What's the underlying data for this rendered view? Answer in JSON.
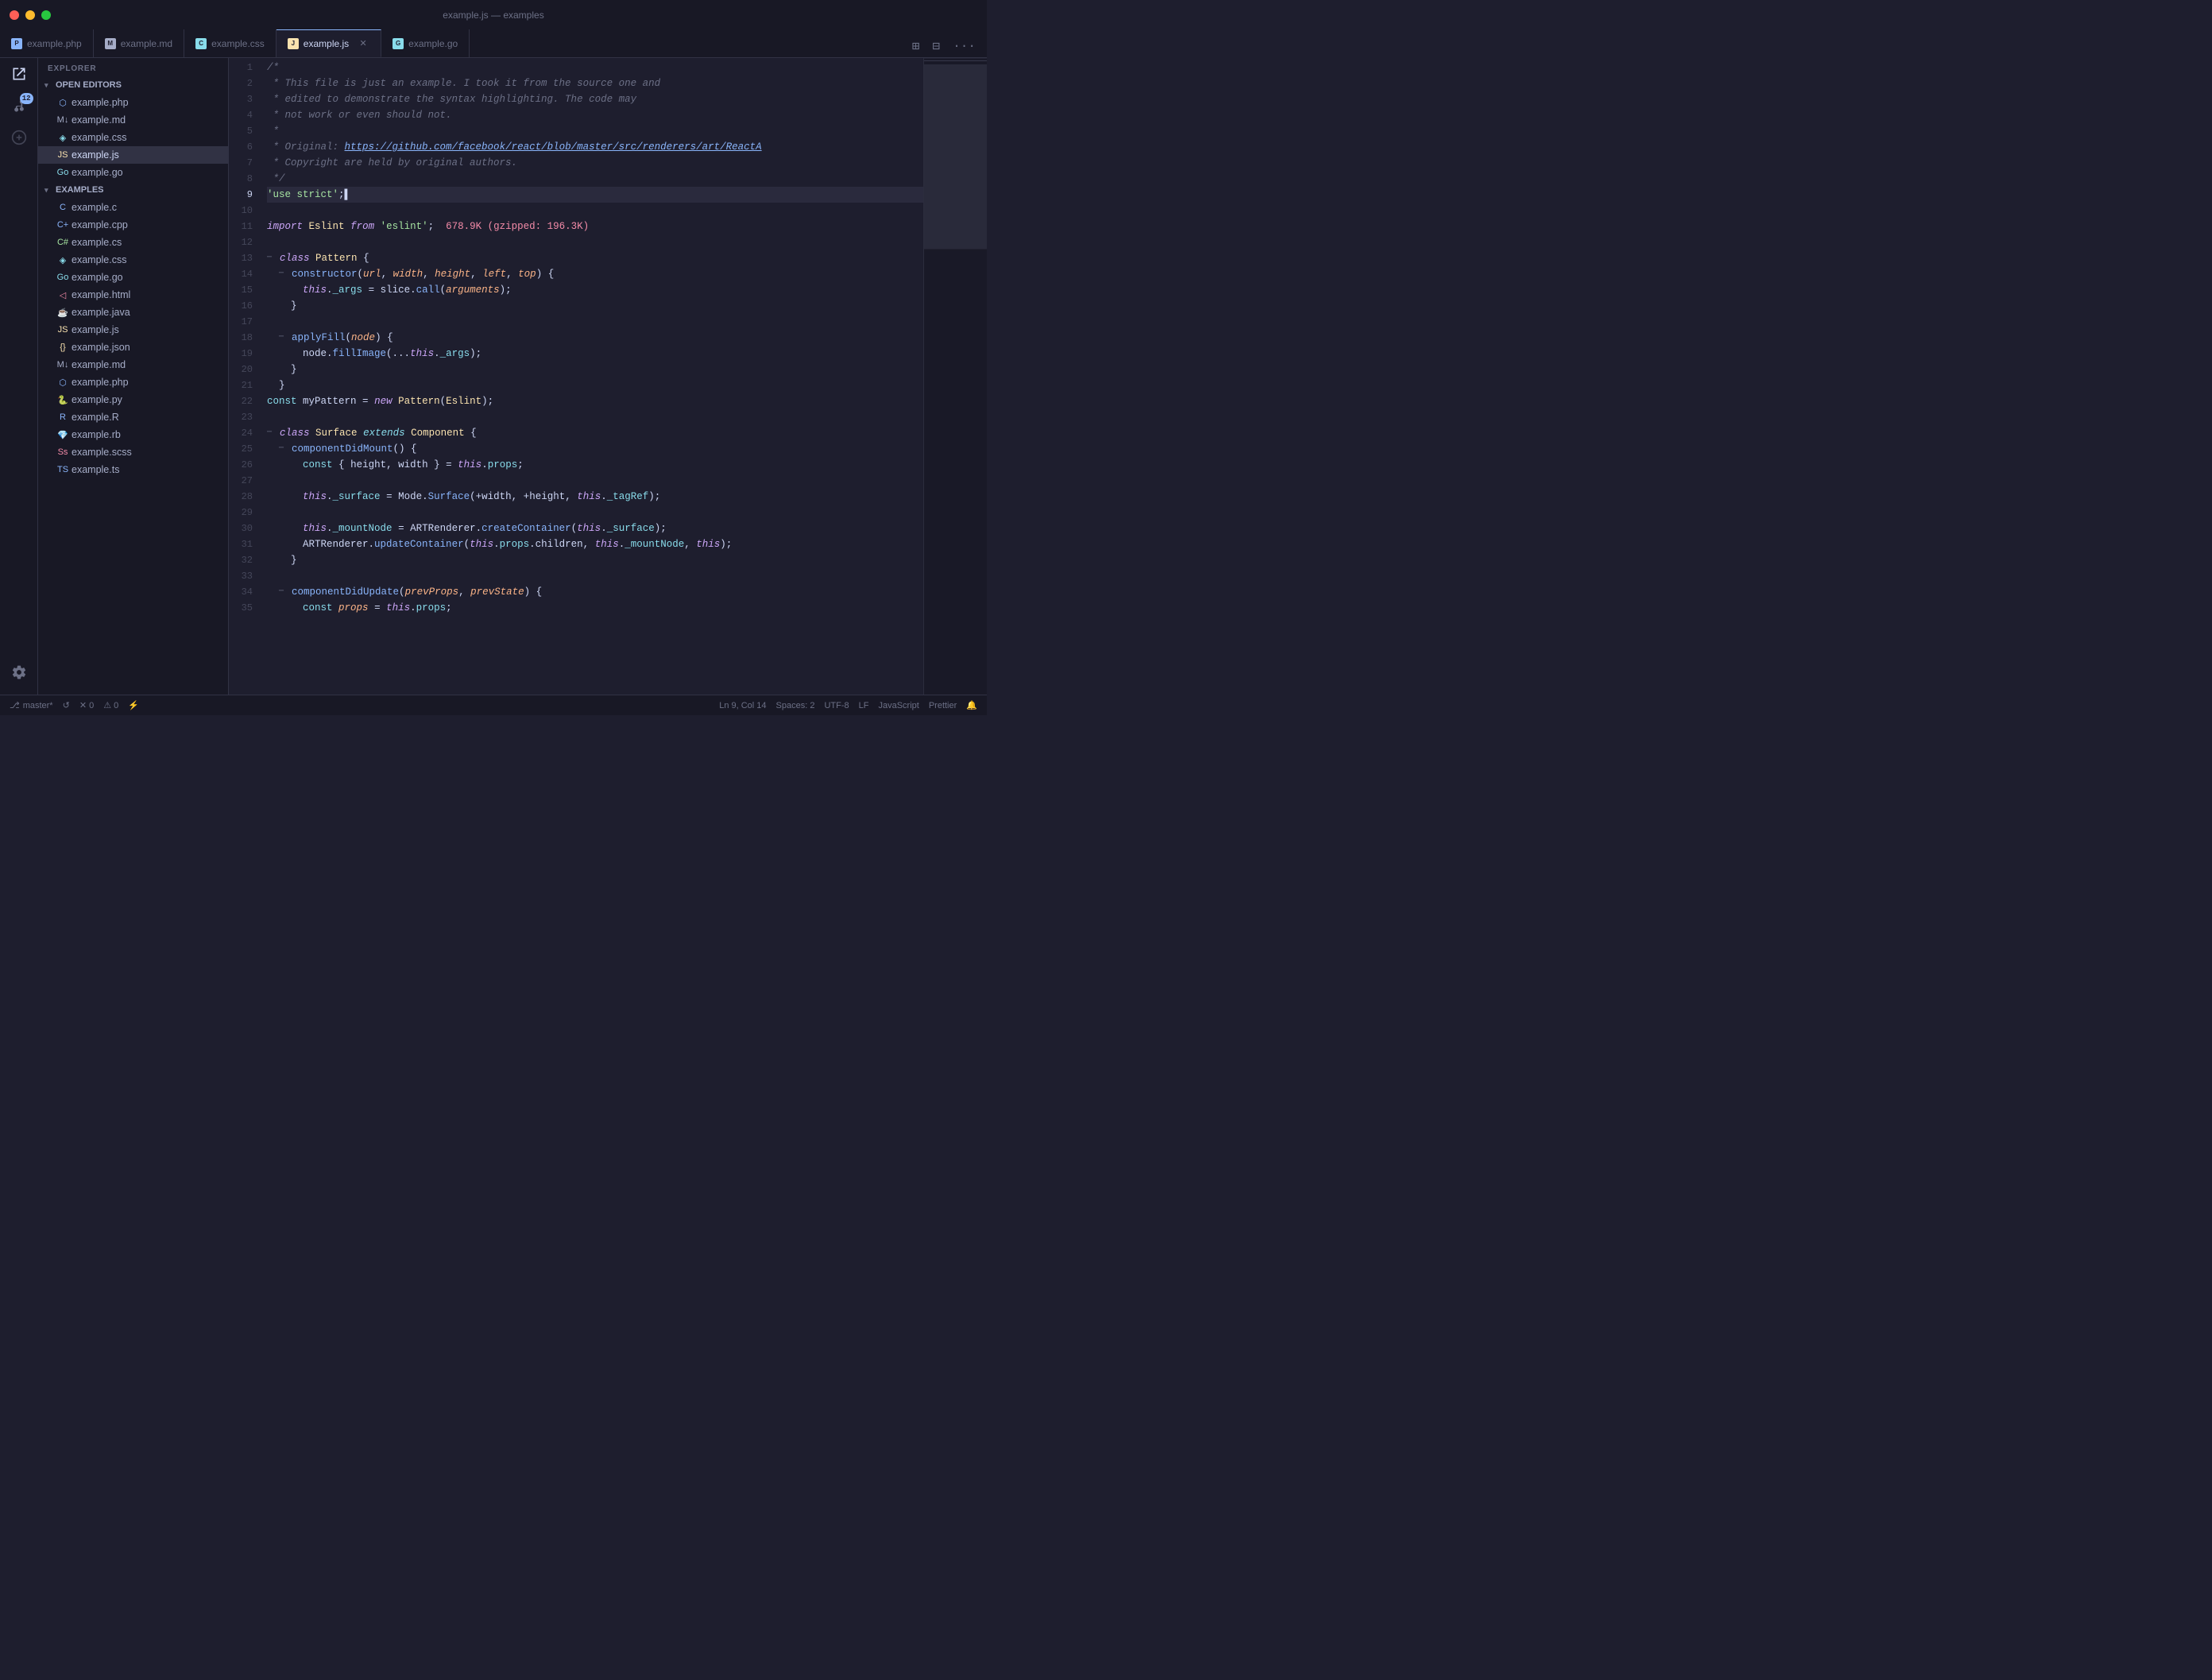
{
  "window": {
    "title": "example.js — examples"
  },
  "tabs": [
    {
      "id": "example-php",
      "label": "example.php",
      "icon_color": "#89b4fa",
      "icon_type": "php",
      "active": false
    },
    {
      "id": "example-md",
      "label": "example.md",
      "icon_color": "#a6adc8",
      "icon_type": "md",
      "active": false
    },
    {
      "id": "example-css",
      "label": "example.css",
      "icon_color": "#89dceb",
      "icon_type": "css",
      "active": false
    },
    {
      "id": "example-js",
      "label": "example.js",
      "icon_color": "#f9e2af",
      "icon_type": "js",
      "active": true,
      "closeable": true
    },
    {
      "id": "example-go",
      "label": "example.go",
      "icon_color": "#89dceb",
      "icon_type": "go",
      "active": false
    }
  ],
  "sidebar": {
    "open_editors_title": "OPEN EDITORS",
    "open_editors": [
      {
        "label": "example.php",
        "icon_color": "#89b4fa"
      },
      {
        "label": "example.md",
        "icon_color": "#a6adc8"
      },
      {
        "label": "example.css",
        "icon_color": "#89dceb"
      },
      {
        "label": "example.js",
        "icon_color": "#f9e2af",
        "active": true
      },
      {
        "label": "example.go",
        "icon_color": "#89dceb"
      }
    ],
    "examples_title": "EXAMPLES",
    "examples": [
      {
        "label": "example.c",
        "icon_color": "#89b4fa"
      },
      {
        "label": "example.cpp",
        "icon_color": "#89b4fa"
      },
      {
        "label": "example.cs",
        "icon_color": "#a6e3a1"
      },
      {
        "label": "example.css",
        "icon_color": "#89dceb"
      },
      {
        "label": "example.go",
        "icon_color": "#89dceb"
      },
      {
        "label": "example.html",
        "icon_color": "#f38ba8"
      },
      {
        "label": "example.java",
        "icon_color": "#f38ba8"
      },
      {
        "label": "example.js",
        "icon_color": "#f9e2af"
      },
      {
        "label": "example.json",
        "icon_color": "#f9e2af"
      },
      {
        "label": "example.md",
        "icon_color": "#a6adc8"
      },
      {
        "label": "example.php",
        "icon_color": "#89b4fa"
      },
      {
        "label": "example.py",
        "icon_color": "#f9e2af"
      },
      {
        "label": "example.R",
        "icon_color": "#89b4fa"
      },
      {
        "label": "example.rb",
        "icon_color": "#f38ba8"
      },
      {
        "label": "example.scss",
        "icon_color": "#f38ba8"
      },
      {
        "label": "example.ts",
        "icon_color": "#89b4fa"
      }
    ]
  },
  "status_bar": {
    "branch": "master*",
    "sync": "↺",
    "errors": "✕ 0",
    "warnings": "⚠ 0",
    "lightning": "⚡",
    "line_col": "Ln 9, Col 14",
    "spaces": "Spaces: 2",
    "encoding": "UTF-8",
    "line_ending": "LF",
    "language": "JavaScript",
    "formatter": "Prettier",
    "bell": "🔔"
  },
  "code": {
    "lines": [
      {
        "num": 1,
        "content": "/*"
      },
      {
        "num": 2,
        "content": " * This file is just an example. I took it from the source one and"
      },
      {
        "num": 3,
        "content": " * edited to demonstrate the syntax highlighting. The code may"
      },
      {
        "num": 4,
        "content": " * not work or even should not."
      },
      {
        "num": 5,
        "content": " *"
      },
      {
        "num": 6,
        "content": " * Original: https://github.com/facebook/react/blob/master/src/renderers/art/ReactA"
      },
      {
        "num": 7,
        "content": " * Copyright are held by original authors."
      },
      {
        "num": 8,
        "content": " */"
      },
      {
        "num": 9,
        "content": "'use strict';",
        "active": true
      },
      {
        "num": 10,
        "content": ""
      },
      {
        "num": 11,
        "content": "import Eslint from 'eslint';  678.9K (gzipped: 196.3K)",
        "has_import_size": true
      },
      {
        "num": 12,
        "content": ""
      },
      {
        "num": 13,
        "content": "- class Pattern {",
        "fold": true
      },
      {
        "num": 14,
        "content": "  - constructor(url, width, height, left, top) {",
        "fold": true
      },
      {
        "num": 15,
        "content": "      this._args = slice.call(arguments);"
      },
      {
        "num": 16,
        "content": "    }"
      },
      {
        "num": 17,
        "content": ""
      },
      {
        "num": 18,
        "content": "  - applyFill(node) {",
        "fold": true
      },
      {
        "num": 19,
        "content": "      node.fillImage(...this._args);",
        "marker": true
      },
      {
        "num": 20,
        "content": "    }"
      },
      {
        "num": 21,
        "content": "  }"
      },
      {
        "num": 22,
        "content": "const myPattern = new Pattern(Eslint);",
        "marker": true
      },
      {
        "num": 23,
        "content": ""
      },
      {
        "num": 24,
        "content": "- class Surface extends Component {",
        "fold": true
      },
      {
        "num": 25,
        "content": "  - componentDidMount() {",
        "fold": true
      },
      {
        "num": 26,
        "content": "      const { height, width } = this.props;",
        "marker": true
      },
      {
        "num": 27,
        "content": ""
      },
      {
        "num": 28,
        "content": "      this._surface = Mode.Surface(+width, +height, this._tagRef);"
      },
      {
        "num": 29,
        "content": ""
      },
      {
        "num": 30,
        "content": "      this._mountNode = ARTRenderer.createContainer(this._surface);"
      },
      {
        "num": 31,
        "content": "      ARTRenderer.updateContainer(this.props.children, this._mountNode, this);"
      },
      {
        "num": 32,
        "content": "    }"
      },
      {
        "num": 33,
        "content": ""
      },
      {
        "num": 34,
        "content": "  - componentDidUpdate(prevProps, prevState) {",
        "fold": true
      },
      {
        "num": 35,
        "content": "      const props = this.props;"
      }
    ]
  }
}
